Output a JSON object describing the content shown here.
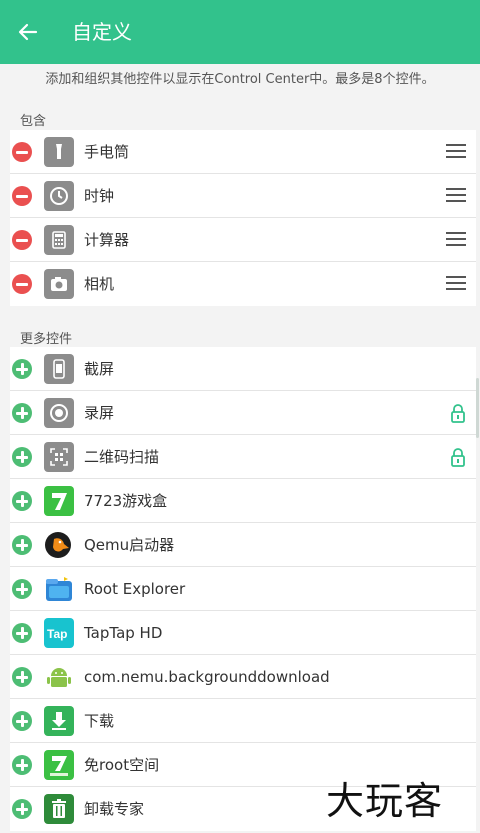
{
  "header": {
    "title": "自定义",
    "back_icon": "arrow-left-icon"
  },
  "description": "添加和组织其他控件以显示在Control Center中。最多是8个控件。",
  "included": {
    "title": "包含",
    "items": [
      {
        "label": "手电筒",
        "icon": "flashlight-icon"
      },
      {
        "label": "时钟",
        "icon": "clock-icon"
      },
      {
        "label": "计算器",
        "icon": "calculator-icon"
      },
      {
        "label": "相机",
        "icon": "camera-icon"
      }
    ]
  },
  "more": {
    "title": "更多控件",
    "items": [
      {
        "label": "截屏",
        "icon": "screenshot-icon",
        "locked": false
      },
      {
        "label": "录屏",
        "icon": "record-icon",
        "locked": true
      },
      {
        "label": "二维码扫描",
        "icon": "qr-scan-icon",
        "locked": true
      },
      {
        "label": "7723游戏盒",
        "icon": "app-7723-icon",
        "locked": false
      },
      {
        "label": "Qemu启动器",
        "icon": "qemu-icon",
        "locked": false
      },
      {
        "label": "Root Explorer",
        "icon": "root-explorer-icon",
        "locked": false
      },
      {
        "label": "TapTap HD",
        "icon": "taptap-icon",
        "locked": false
      },
      {
        "label": "com.nemu.backgrounddownload",
        "icon": "android-icon",
        "locked": false
      },
      {
        "label": "下载",
        "icon": "download-icon",
        "locked": false
      },
      {
        "label": "免root空间",
        "icon": "app-7-green-icon",
        "locked": false
      },
      {
        "label": "卸载专家",
        "icon": "uninstall-icon",
        "locked": false
      }
    ]
  },
  "watermark": "大玩客",
  "colors": {
    "accent": "#32c28c",
    "remove": "#ea5050",
    "add": "#4dbd74"
  }
}
